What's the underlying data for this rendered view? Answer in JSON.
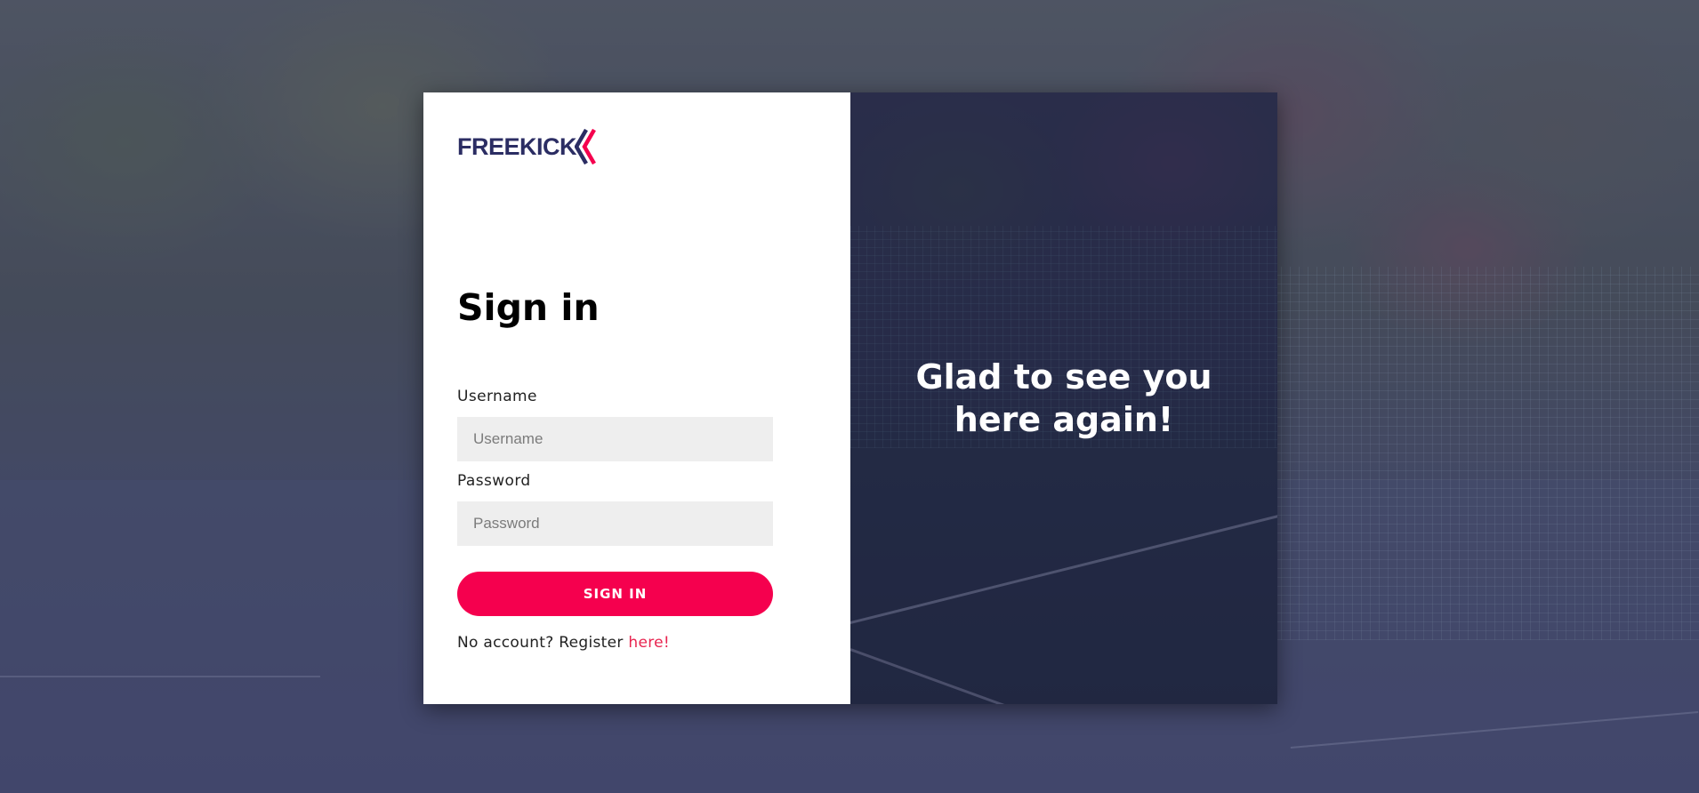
{
  "background": {
    "overlay_color": "#37376e"
  },
  "brand": {
    "name": "FREEKICK",
    "wordmark_color": "#2b2d63",
    "accent_color": "#f5004e"
  },
  "form": {
    "title": "Sign in",
    "username_label": "Username",
    "username_placeholder": "Username",
    "username_value": "",
    "password_label": "Password",
    "password_placeholder": "Password",
    "password_value": "",
    "submit_label": "SIGN IN",
    "register_prompt": "No account? Register ",
    "register_link": "here!"
  },
  "welcome": {
    "tagline_line1": "Glad to see you",
    "tagline_line2": "here again!"
  }
}
